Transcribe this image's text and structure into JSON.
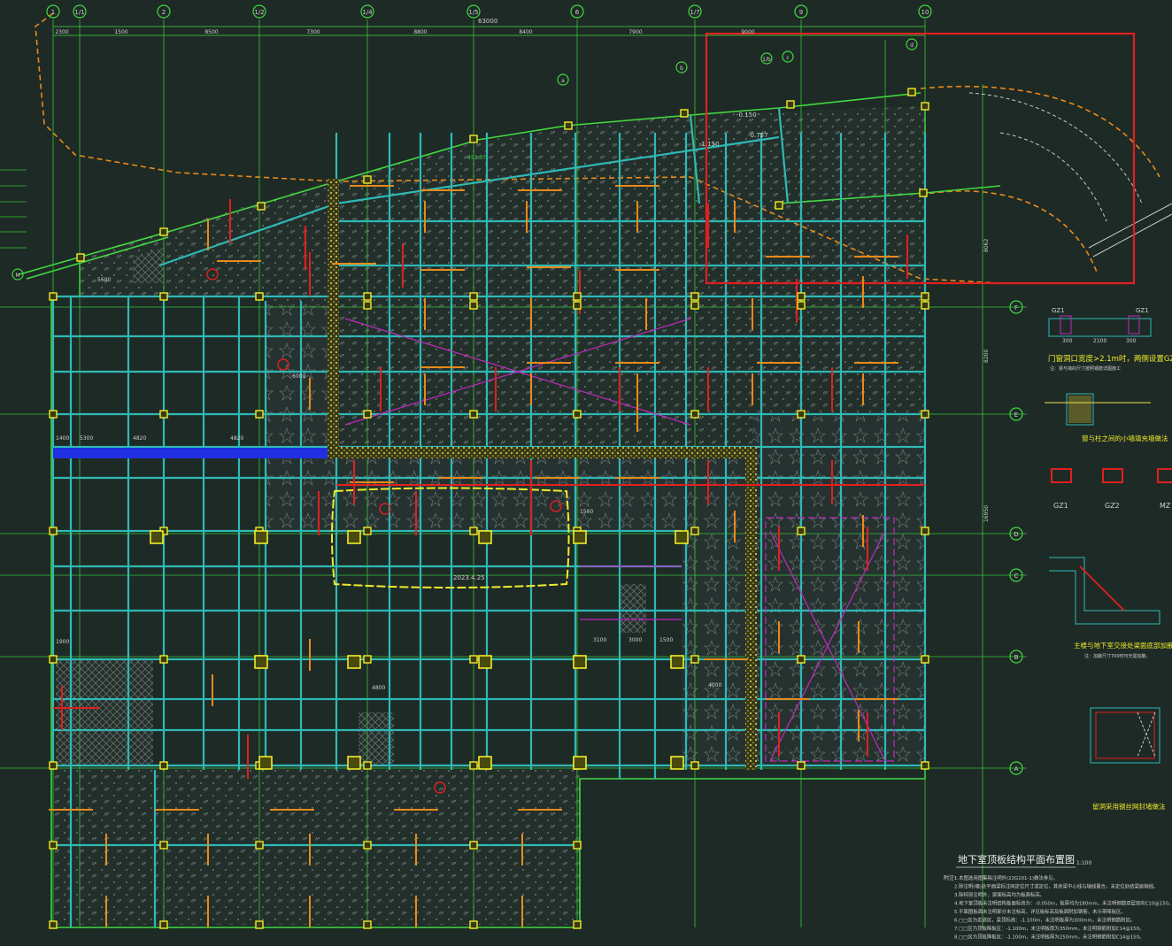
{
  "drawing": {
    "title": "地下室顶板结构平面布置图",
    "scale": "1:100",
    "notes_heading": "附注:",
    "notes": [
      "1.本图选用图集除注明外(22G101-1)做法参见。",
      "2.除注明(墙)处平面梁标注同定位尺寸或定位，其余梁中心线与轴线重合，未定位处结梁居轴线。",
      "3.除特别注明外，梁面标高均为板面标高。",
      "4.地下室顶板未注明结构板面标高为：-0.050m，板厚均为180mm，未注明钢筋双层双向C10@150。",
      "5.平面图板面未注明部分未注标高，详见板标高及板面附加钢筋，未示带降板区。",
      "6.□□区为走道区，梁顶标高：-1.100m，未注明板厚为300mm，未注明钢筋附加。",
      "7.□□区为顶板降板区：-1.100m，未注明板厚为350mm，未注明钢筋附加C14@150。",
      "8.□□区为顶板降板区：-1.100m，未注明板厚为250mm，未注明钢筋附加C14@150。"
    ]
  },
  "axes": {
    "top": [
      "1",
      "1/1",
      "2",
      "1/2",
      "1/4",
      "1/5",
      "6",
      "1/7",
      "9",
      "10"
    ],
    "top_dimensions": [
      "2300",
      "1500",
      "8500",
      "7300",
      "8800",
      "8400",
      "7900",
      "9000"
    ],
    "total_dimension": "63000",
    "right": [
      "F",
      "E",
      "D",
      "C",
      "B",
      "A"
    ],
    "right_dimensions": [
      "8200",
      "16950",
      "8062"
    ],
    "curved": [
      "a",
      "b",
      "1/b",
      "c",
      "d",
      "M"
    ]
  },
  "annotations": {
    "elevation_1": "-1.150",
    "elevation_2": "-0.757",
    "elevation_3": "-0.150",
    "circle_label": "453.37",
    "yellow_zone_label": "2023.4.25",
    "dims_left": [
      "1400",
      "5300",
      "4820",
      "4820",
      "6000",
      "1900",
      "5600"
    ],
    "dims_mid": [
      "1560",
      "4800",
      "3100",
      "4000",
      "3000",
      "1500"
    ]
  },
  "details": {
    "gz1_title": "门窗洞口宽度>2.1m时，两侧设置GZ1",
    "gz1_note": "注：梁与墙的尺寸按照钢筋详图施工",
    "gz1_tag": "GZ1",
    "gz1_tag2": "GZ1",
    "gz1_dims": [
      "300",
      "2100",
      "300"
    ],
    "wall_detail_title": "窗与柱之间的小墙填充墙做法",
    "column_types": [
      "GZ1",
      "GZ2",
      "MZ"
    ],
    "junction_title": "主楼与地下室交接处梁面底部加腋大样",
    "junction_note": "注：加腋尺寸700时可无需加腋。",
    "opening_title": "留洞采用钢丝网封堵做法"
  }
}
